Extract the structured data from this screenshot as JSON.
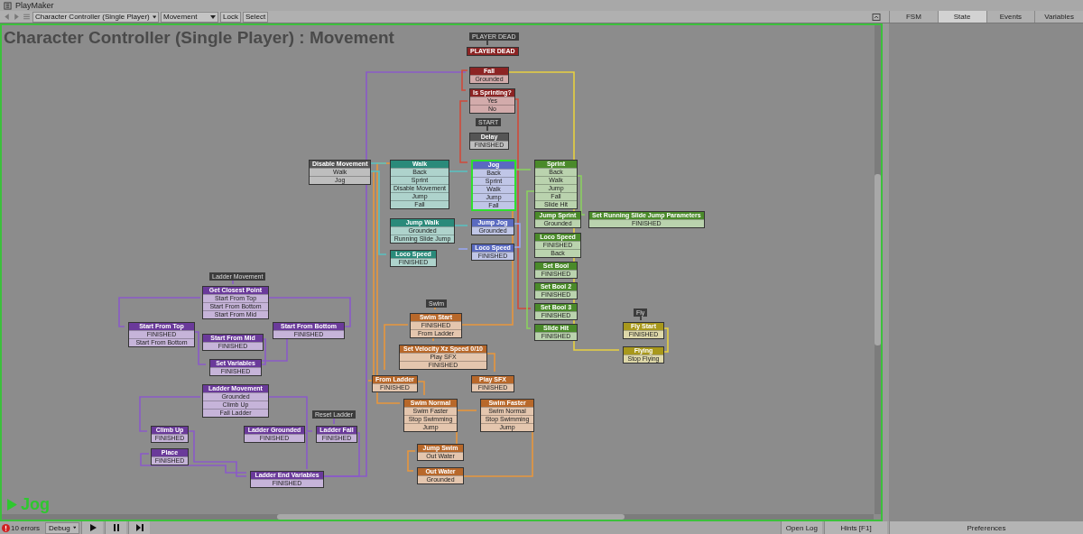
{
  "window": {
    "title": "PlayMaker"
  },
  "toolbar": {
    "fsm_owner": "Character Controller (Single Player)",
    "fsm_name": "Movement",
    "buttons": [
      "Lock",
      "Select"
    ]
  },
  "panel_tabs": [
    {
      "label": "FSM",
      "selected": false
    },
    {
      "label": "State",
      "selected": true
    },
    {
      "label": "Events",
      "selected": false
    },
    {
      "label": "Variables",
      "selected": false
    }
  ],
  "graph": {
    "title": "Character Controller (Single Player) : Movement",
    "active_state": "Jog",
    "global_events": [
      "PLAYER DEAD",
      "START",
      "Swim",
      "Ladder Movement",
      "Reset Ladder",
      "Fly"
    ],
    "states": [
      {
        "name": "PLAYER DEAD",
        "color": "#8c2323",
        "selected": false
      },
      {
        "name": "Fall",
        "color": "#8c2323",
        "selected": false,
        "events": [
          "Grounded"
        ]
      },
      {
        "name": "Is Sprinting?",
        "color": "#8c2323",
        "selected": false,
        "events": [
          "Yes",
          "No"
        ]
      },
      {
        "name": "Delay",
        "color": "#555555",
        "selected": false,
        "events": [
          "FINISHED"
        ]
      },
      {
        "name": "Disable Movement",
        "color": "#555555",
        "selected": false,
        "events": [
          "Walk",
          "Jog"
        ]
      },
      {
        "name": "Walk",
        "color": "#2a8a7a",
        "selected": false,
        "events": [
          "Back",
          "Sprint",
          "Disable Movement",
          "Jump",
          "Fall"
        ]
      },
      {
        "name": "Jog",
        "color": "#5a6ac0",
        "selected": true,
        "events": [
          "Back",
          "Sprint",
          "Walk",
          "Jump",
          "Fall"
        ]
      },
      {
        "name": "Sprint",
        "color": "#4a8a2a",
        "selected": false,
        "events": [
          "Back",
          "Walk",
          "Jump",
          "Fall",
          "Slide Hit"
        ]
      },
      {
        "name": "Jump Walk",
        "color": "#2a8a7a",
        "selected": false,
        "events": [
          "Grounded",
          "Running Slide Jump"
        ]
      },
      {
        "name": "Jump Jog",
        "color": "#5a6ac0",
        "selected": false,
        "events": [
          "Grounded"
        ]
      },
      {
        "name": "Jump Sprint",
        "color": "#4a8a2a",
        "selected": false,
        "events": [
          "Grounded"
        ]
      },
      {
        "name": "Set Running Slide Jump Parameters",
        "color": "#4a8a2a",
        "selected": false,
        "events": [
          "FINISHED"
        ]
      },
      {
        "name": "Loco Speed",
        "color": "#2a8a7a",
        "selected": false,
        "events": [
          "FINISHED"
        ]
      },
      {
        "name": "Loco Speed",
        "color": "#5a6ac0",
        "selected": false,
        "events": [
          "FINISHED"
        ]
      },
      {
        "name": "Loco Speed",
        "color": "#4a8a2a",
        "selected": false,
        "events": [
          "FINISHED",
          "Back"
        ]
      },
      {
        "name": "Set Bool",
        "color": "#4a8a2a",
        "selected": false,
        "events": [
          "FINISHED"
        ]
      },
      {
        "name": "Set Bool 2",
        "color": "#4a8a2a",
        "selected": false,
        "events": [
          "FINISHED"
        ]
      },
      {
        "name": "Set Bool 3",
        "color": "#4a8a2a",
        "selected": false,
        "events": [
          "FINISHED"
        ]
      },
      {
        "name": "Slide Hit",
        "color": "#4a8a2a",
        "selected": false,
        "events": [
          "FINISHED"
        ]
      },
      {
        "name": "Fly Start",
        "color": "#a8981c",
        "selected": false,
        "events": [
          "FINISHED"
        ]
      },
      {
        "name": "Flying",
        "color": "#a8981c",
        "selected": false,
        "events": [
          "Stop Flying"
        ]
      },
      {
        "name": "Swim Start",
        "color": "#b8682a",
        "selected": false,
        "events": [
          "FINISHED",
          "From Ladder"
        ]
      },
      {
        "name": "Set Velocity Xz Speed 0/10",
        "color": "#b8682a",
        "selected": false,
        "events": [
          "Play SFX",
          "FINISHED"
        ]
      },
      {
        "name": "From Ladder",
        "color": "#b8682a",
        "selected": false,
        "events": [
          "FINISHED"
        ]
      },
      {
        "name": "Play SFX",
        "color": "#b8682a",
        "selected": false,
        "events": [
          "FINISHED"
        ]
      },
      {
        "name": "Swim Normal",
        "color": "#b8682a",
        "selected": false,
        "events": [
          "Swim Faster",
          "Stop Swimming",
          "Jump"
        ]
      },
      {
        "name": "Swim Faster",
        "color": "#b8682a",
        "selected": false,
        "events": [
          "Swim Normal",
          "Stop Swimming",
          "Jump"
        ]
      },
      {
        "name": "Jump Swim",
        "color": "#b8682a",
        "selected": false,
        "events": [
          "Out Water"
        ]
      },
      {
        "name": "Out Water",
        "color": "#b8682a",
        "selected": false,
        "events": [
          "Grounded"
        ]
      },
      {
        "name": "Get Closest Point",
        "color": "#6a3a9a",
        "selected": false,
        "events": [
          "Start From Top",
          "Start From Bottom",
          "Start From Mid"
        ]
      },
      {
        "name": "Start From Top",
        "color": "#6a3a9a",
        "selected": false,
        "events": [
          "FINISHED",
          "Start From Bottom"
        ]
      },
      {
        "name": "Start From Bottom",
        "color": "#6a3a9a",
        "selected": false,
        "events": [
          "FINISHED"
        ]
      },
      {
        "name": "Start From Mid",
        "color": "#6a3a9a",
        "selected": false,
        "events": [
          "FINISHED"
        ]
      },
      {
        "name": "Set Variables",
        "color": "#6a3a9a",
        "selected": false,
        "events": [
          "FINISHED"
        ]
      },
      {
        "name": "Ladder Movement",
        "color": "#6a3a9a",
        "selected": false,
        "events": [
          "Grounded",
          "Climb Up",
          "Fall Ladder"
        ]
      },
      {
        "name": "Climb Up",
        "color": "#6a3a9a",
        "selected": false,
        "events": [
          "FINISHED"
        ]
      },
      {
        "name": "Place",
        "color": "#6a3a9a",
        "selected": false,
        "events": [
          "FINISHED"
        ]
      },
      {
        "name": "Ladder Grounded",
        "color": "#6a3a9a",
        "selected": false,
        "events": [
          "FINISHED"
        ]
      },
      {
        "name": "Ladder Fall",
        "color": "#6a3a9a",
        "selected": false,
        "events": [
          "FINISHED"
        ]
      },
      {
        "name": "Ladder End Variables",
        "color": "#6a3a9a",
        "selected": false,
        "events": [
          "FINISHED"
        ]
      }
    ]
  },
  "status_bar": {
    "errors": "10 errors",
    "debug": "Debug",
    "open_log": "Open Log",
    "hints": "Hints [F1]",
    "preferences": "Preferences"
  }
}
